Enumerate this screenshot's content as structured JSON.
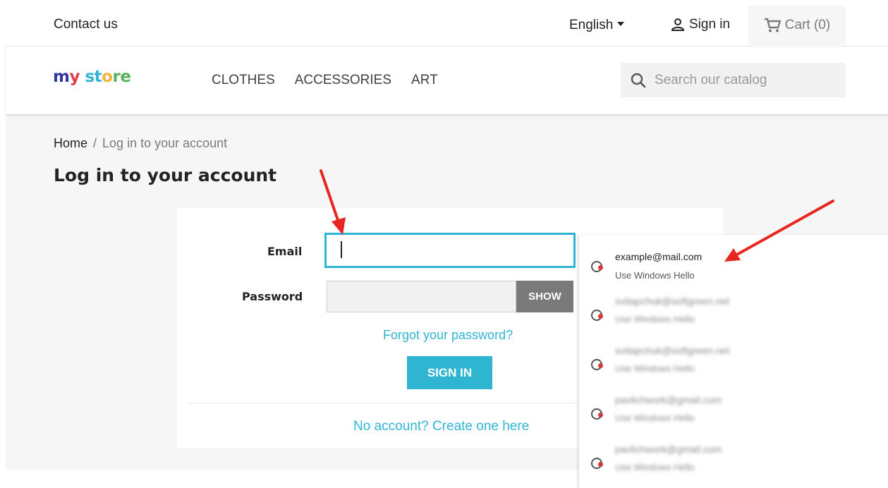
{
  "topbar": {
    "contact": "Contact us",
    "language": "English",
    "signin": "Sign in",
    "cart": "Cart (0)"
  },
  "header": {
    "logo_parts": [
      "m",
      "y",
      " st",
      "o",
      "re"
    ],
    "nav": [
      "CLOTHES",
      "ACCESSORIES",
      "ART"
    ],
    "search_placeholder": "Search our catalog"
  },
  "breadcrumb": {
    "home": "Home",
    "separator": "/",
    "current": "Log in to your account"
  },
  "page_title": "Log in to your account",
  "form": {
    "email_label": "Email",
    "email_value": "",
    "password_label": "Password",
    "show_label": "SHOW",
    "forgot": "Forgot your password?",
    "signin_button": "SIGN IN",
    "create_account": "No account? Create one here"
  },
  "autofill": {
    "items": [
      {
        "email": "example@mail.com",
        "sub": "Use Windows Hello",
        "blurred": false
      },
      {
        "email": "svitapchuk@softgreen.net",
        "sub": "Use Windows Hello",
        "blurred": true
      },
      {
        "email": "svitapchuk@softgreen.net",
        "sub": "Use Windows Hello",
        "blurred": true
      },
      {
        "email": "pavlichwork@gmail.com",
        "sub": "Use Windows Hello",
        "blurred": true
      },
      {
        "email": "pavlichwork@gmail.com",
        "sub": "Use Windows Hello",
        "blurred": true
      }
    ]
  },
  "colors": {
    "accent": "#2fb5d2",
    "arrow": "#e8261f",
    "page_bg": "#f6f6f6"
  }
}
